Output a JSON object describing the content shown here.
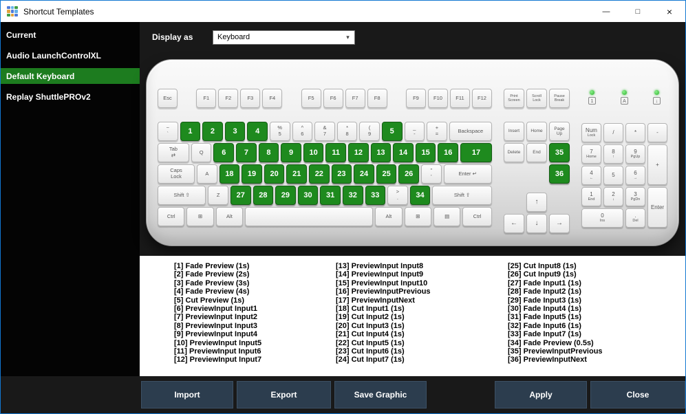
{
  "window": {
    "title": "Shortcut Templates",
    "minimize_glyph": "—",
    "maximize_glyph": "□",
    "close_glyph": "×",
    "logo_colors": [
      "#4f7bd9",
      "#65b1e8",
      "#3f9e46",
      "#e0a23e",
      "#4f7bd9",
      "#65b1e8",
      "#3f9e46",
      "#e0a23e",
      "#4f7bd9"
    ]
  },
  "colors": {
    "accent_green": "#1e8a1e",
    "sidebar_selected": "#1d7c1f",
    "dark_bg": "#191919",
    "button_bg": "#2c3d4e",
    "button_border": "#3c5064",
    "window_border": "#1177d1",
    "led_green": "#2fb32f"
  },
  "sidebar": {
    "items": [
      {
        "label": "Current",
        "selected": false
      },
      {
        "label": "Audio LaunchControlXL",
        "selected": false
      },
      {
        "label": "Default Keyboard",
        "selected": true
      },
      {
        "label": "Replay ShuttlePROv2",
        "selected": false
      }
    ]
  },
  "topbar": {
    "display_as_label": "Display as",
    "dropdown_value": "Keyboard",
    "dropdown_arrow": "▾"
  },
  "keyboard": {
    "function_groups": [
      [
        "Esc"
      ],
      [
        "F1",
        "F2",
        "F3",
        "F4"
      ],
      [
        "F5",
        "F6",
        "F7",
        "F8"
      ],
      [
        "F9",
        "F10",
        "F11",
        "F12"
      ]
    ],
    "nav_function_keys": [
      [
        "Print",
        "Screen"
      ],
      [
        "Scroll",
        "Lock"
      ],
      [
        "Pause",
        "Break"
      ]
    ],
    "led_icons": [
      "1",
      "A",
      "↓"
    ],
    "main_rows": [
      [
        {
          "l": [
            "~",
            "`"
          ]
        },
        {
          "g": "1"
        },
        {
          "g": "2"
        },
        {
          "g": "3"
        },
        {
          "g": "4"
        },
        {
          "l": [
            "%",
            "5"
          ]
        },
        {
          "l": [
            "^",
            "6"
          ]
        },
        {
          "l": [
            "&",
            "7"
          ]
        },
        {
          "l": [
            "*",
            "8"
          ]
        },
        {
          "l": [
            "(",
            "9"
          ]
        },
        {
          "g": "5"
        },
        {
          "l": [
            "_",
            "-"
          ]
        },
        {
          "l": [
            "+",
            "="
          ]
        },
        {
          "l": [
            "Backspace"
          ],
          "w": 2
        }
      ],
      [
        {
          "l": [
            "Tab",
            "⇄"
          ],
          "w": 1.5
        },
        {
          "l": [
            "Q"
          ]
        },
        {
          "g": "6"
        },
        {
          "g": "7"
        },
        {
          "g": "8"
        },
        {
          "g": "9"
        },
        {
          "g": "10"
        },
        {
          "g": "11"
        },
        {
          "g": "12"
        },
        {
          "g": "13"
        },
        {
          "g": "14"
        },
        {
          "g": "15"
        },
        {
          "g": "16"
        },
        {
          "g": "17",
          "w": 1.5
        }
      ],
      [
        {
          "l": [
            "Caps",
            "Lock"
          ],
          "w": 1.75
        },
        {
          "l": [
            "A"
          ]
        },
        {
          "g": "18"
        },
        {
          "g": "19"
        },
        {
          "g": "20"
        },
        {
          "g": "21"
        },
        {
          "g": "22"
        },
        {
          "g": "23"
        },
        {
          "g": "24"
        },
        {
          "g": "25"
        },
        {
          "g": "26"
        },
        {
          "l": [
            "\"",
            "'"
          ]
        },
        {
          "l": [
            "Enter ↵"
          ],
          "w": 2.25
        }
      ],
      [
        {
          "l": [
            "Shift ⇧"
          ],
          "w": 2.25
        },
        {
          "l": [
            "Z"
          ]
        },
        {
          "g": "27"
        },
        {
          "g": "28"
        },
        {
          "g": "29"
        },
        {
          "g": "30"
        },
        {
          "g": "31"
        },
        {
          "g": "32"
        },
        {
          "g": "33"
        },
        {
          "l": [
            ">",
            "."
          ]
        },
        {
          "g": "34"
        },
        {
          "l": [
            "Shift ⇧"
          ],
          "w": 2.75
        }
      ],
      [
        {
          "l": [
            "Ctrl"
          ],
          "w": 1.3
        },
        {
          "l": [
            "⊞"
          ],
          "w": 1.3
        },
        {
          "l": [
            "Alt"
          ],
          "w": 1.3
        },
        {
          "l": [
            ""
          ],
          "w": 5.8
        },
        {
          "l": [
            "Alt"
          ],
          "w": 1.3
        },
        {
          "l": [
            "⊞"
          ],
          "w": 1.3
        },
        {
          "l": [
            "▤"
          ],
          "w": 1.3
        },
        {
          "l": [
            "Ctrl"
          ],
          "w": 1.4
        }
      ]
    ],
    "nav_rows": [
      [
        {
          "l": [
            "Insert"
          ]
        },
        {
          "l": [
            "Home"
          ]
        },
        {
          "l": [
            "Page",
            "Up"
          ]
        }
      ],
      [
        {
          "l": [
            "Delete"
          ]
        },
        {
          "l": [
            "End"
          ]
        },
        {
          "g": "35"
        }
      ],
      [
        null,
        null,
        {
          "g": "36"
        }
      ]
    ],
    "arrow_rows": [
      [
        null,
        {
          "l": [
            "↑"
          ]
        },
        null
      ],
      [
        {
          "l": [
            "←"
          ]
        },
        {
          "l": [
            "↓"
          ]
        },
        {
          "l": [
            "→"
          ]
        }
      ]
    ],
    "numpad": [
      {
        "l": [
          "Num",
          "Lock"
        ]
      },
      {
        "l": [
          "/"
        ]
      },
      {
        "l": [
          "*"
        ]
      },
      {
        "l": [
          "-"
        ]
      },
      {
        "l": [
          "7",
          "Home"
        ]
      },
      {
        "l": [
          "8",
          "↑"
        ]
      },
      {
        "l": [
          "9",
          "PgUp"
        ]
      },
      {
        "l": [
          "+"
        ],
        "rs": 2
      },
      {
        "l": [
          "4",
          "←"
        ]
      },
      {
        "l": [
          "5"
        ]
      },
      {
        "l": [
          "6",
          "→"
        ]
      },
      {
        "l": [
          "1",
          "End"
        ]
      },
      {
        "l": [
          "2",
          "↓"
        ]
      },
      {
        "l": [
          "3",
          "PgDn"
        ]
      },
      {
        "l": [
          "Enter"
        ],
        "rs": 2
      },
      {
        "l": [
          "0",
          "Ins"
        ],
        "cs": 2
      },
      {
        "l": [
          ".",
          "Del"
        ]
      }
    ]
  },
  "shortcuts": {
    "columns": [
      [
        "[1] Fade Preview (1s)",
        "[2] Fade Preview (2s)",
        "[3] Fade Preview (3s)",
        "[4] Fade Preview (4s)",
        "[5] Cut Preview (1s)",
        "[6] PreviewInput Input1",
        "[7] PreviewInput Input2",
        "[8] PreviewInput Input3",
        "[9] PreviewInput Input4",
        "[10] PreviewInput Input5",
        "[11] PreviewInput Input6",
        "[12] PreviewInput Input7"
      ],
      [
        "[13] PreviewInput Input8",
        "[14] PreviewInput Input9",
        "[15] PreviewInput Input10",
        "[16] PreviewInputPrevious",
        "[17] PreviewInputNext",
        "[18] Cut Input1 (1s)",
        "[19] Cut Input2 (1s)",
        "[20] Cut Input3 (1s)",
        "[21] Cut Input4 (1s)",
        "[22] Cut Input5 (1s)",
        "[23] Cut Input6 (1s)",
        "[24] Cut Input7 (1s)"
      ],
      [
        "[25] Cut Input8 (1s)",
        "[26] Cut Input9 (1s)",
        "[27] Fade Input1 (1s)",
        "[28] Fade Input2 (1s)",
        "[29] Fade Input3 (1s)",
        "[30] Fade Input4 (1s)",
        "[31] Fade Input5 (1s)",
        "[32] Fade Input6 (1s)",
        "[33] Fade Input7 (1s)",
        "[34] Fade Preview (0.5s)",
        "[35] PreviewInputPrevious",
        "[36] PreviewInputNext"
      ]
    ]
  },
  "footer": {
    "buttons": [
      {
        "label": "Import"
      },
      {
        "label": "Export"
      },
      {
        "label": "Save Graphic"
      },
      {
        "label": "Apply"
      },
      {
        "label": "Close"
      }
    ]
  }
}
